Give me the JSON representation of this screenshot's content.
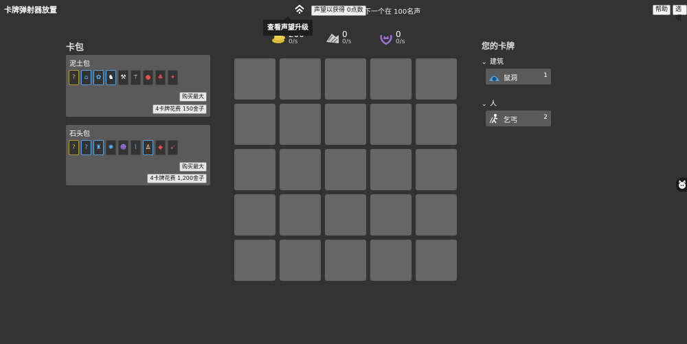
{
  "app": {
    "title": "卡牌弹射器放置"
  },
  "topbar": {
    "prestige_button": "声望以获得 0点数",
    "next_prestige": "下一个在 100名声",
    "help": "帮助",
    "options": "选项",
    "tooltip": "查看声望升级"
  },
  "resources": [
    {
      "name": "gold",
      "value": "200",
      "rate": "0/s",
      "color": "#e0c24a"
    },
    {
      "name": "stone",
      "value": "0",
      "rate": "0/s",
      "color": "#d8d8d8"
    },
    {
      "name": "fame",
      "value": "0",
      "rate": "0/s",
      "color": "#9a6fd8"
    }
  ],
  "packs": {
    "header": "卡包",
    "items": [
      {
        "title": "泥土包",
        "buy_max": "购买最大",
        "cost": "4卡牌花费 150金子",
        "cards": [
          {
            "icon": "question-icon",
            "style": "gold",
            "glyph": "?",
            "color": "#d4b23c"
          },
          {
            "icon": "burrow-icon",
            "style": "blue",
            "glyph": "⌂",
            "color": "#58b6f5"
          },
          {
            "icon": "beast-icon",
            "style": "blue",
            "glyph": "✿",
            "color": "#58b6f5"
          },
          {
            "icon": "rider-icon",
            "style": "blue",
            "glyph": "♞",
            "color": "#ffffff"
          },
          {
            "icon": "tools-icon",
            "style": "",
            "glyph": "⚒",
            "color": "#ffffff"
          },
          {
            "icon": "beggar-icon",
            "style": "",
            "glyph": "⚚",
            "color": "#ffffff"
          },
          {
            "icon": "blob-icon",
            "style": "",
            "glyph": "●",
            "color": "#e05050"
          },
          {
            "icon": "creature-icon",
            "style": "",
            "glyph": "♣",
            "color": "#e05050"
          },
          {
            "icon": "flame-icon",
            "style": "",
            "glyph": "✦",
            "color": "#e05050"
          }
        ]
      },
      {
        "title": "石头包",
        "buy_max": "购买最大",
        "cost": "4卡牌花费 1,200金子",
        "cards": [
          {
            "icon": "question-icon",
            "style": "gold",
            "glyph": "?",
            "color": "#d4b23c"
          },
          {
            "icon": "question-icon",
            "style": "blue",
            "glyph": "?",
            "color": "#58b6f5"
          },
          {
            "icon": "fortress-icon",
            "style": "blue",
            "glyph": "♜",
            "color": "#58b6f5"
          },
          {
            "icon": "crab-icon",
            "style": "",
            "glyph": "✺",
            "color": "#58b6f5"
          },
          {
            "icon": "demon-icon",
            "style": "",
            "glyph": "☻",
            "color": "#9a6fd8"
          },
          {
            "icon": "stairs-icon",
            "style": "",
            "glyph": "⌇",
            "color": "#58b6f5"
          },
          {
            "icon": "figure-icon",
            "style": "blue",
            "glyph": "♙",
            "color": "#ffffff"
          },
          {
            "icon": "shell-icon",
            "style": "",
            "glyph": "◆",
            "color": "#e05050"
          },
          {
            "icon": "wing-icon",
            "style": "",
            "glyph": "➹",
            "color": "#e05050"
          }
        ]
      }
    ]
  },
  "your_cards": {
    "header": "您的卡牌",
    "categories": [
      {
        "name": "建筑",
        "cards": [
          {
            "name": "鼠洞",
            "count": "1",
            "icon": "burrow-icon",
            "color": "#58b6f5"
          }
        ]
      },
      {
        "name": "人",
        "cards": [
          {
            "name": "乞丐",
            "count": "2",
            "icon": "beggar-icon",
            "color": "#ffffff"
          }
        ]
      }
    ]
  }
}
